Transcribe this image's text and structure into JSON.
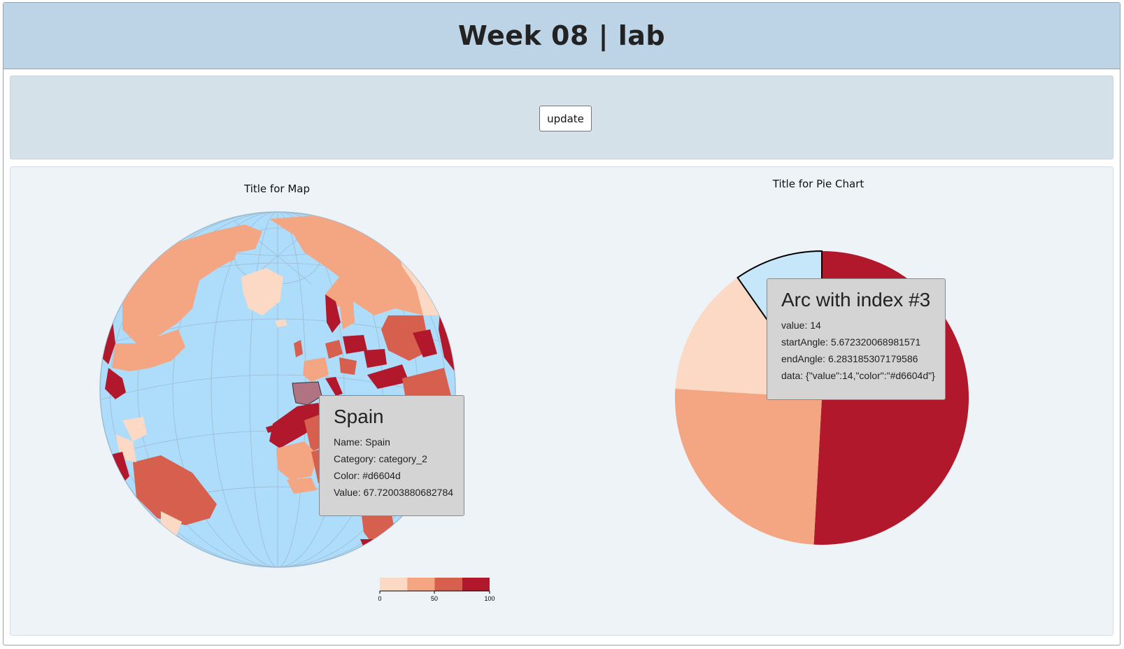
{
  "header": {
    "title": "Week 08 | lab"
  },
  "controls": {
    "update_label": "update"
  },
  "map": {
    "title": "Title for Map",
    "colors": {
      "ocean": "#aedcfb",
      "graticule": "#9cb8cc",
      "c1": "#fcd9c4",
      "c2": "#f4a582",
      "c3": "#d6604d",
      "c4": "#b2182b",
      "highlight": "#b07381"
    },
    "legend": {
      "ticks": [
        "0",
        "50",
        "100"
      ],
      "colors": [
        "#fcd9c4",
        "#f4a582",
        "#d6604d",
        "#b2182b"
      ]
    },
    "tooltip": {
      "title": "Spain",
      "name": "Name: Spain",
      "category": "Category: category_2",
      "color": "Color: #d6604d",
      "value": "Value: 67.72003880682784"
    }
  },
  "pie": {
    "title": "Title for Pie Chart",
    "tooltip": {
      "title": "Arc with index #3",
      "value": "value: 14",
      "start": "startAngle: 5.672320068981571",
      "end": "endAngle: 6.283185307179586",
      "data": "data: {\"value\":14,\"color\":\"#d6604d\"}"
    }
  },
  "chart_data": {
    "type": "pie",
    "title": "Title for Pie Chart",
    "slices": [
      {
        "value": 50,
        "color": "#b2182b",
        "startAngle": 0,
        "endAngle": 3.1966
      },
      {
        "value": 25,
        "color": "#f4a582",
        "startAngle": 3.1966,
        "endAngle": 4.7752
      },
      {
        "value": 13,
        "color": "#fcd9c4",
        "startAngle": 4.7752,
        "endAngle": 5.6723
      },
      {
        "value": 14,
        "color": "#c6e6fa",
        "startAngle": 5.672320068981571,
        "endAngle": 6.283185307179586,
        "highlighted": true
      }
    ]
  }
}
